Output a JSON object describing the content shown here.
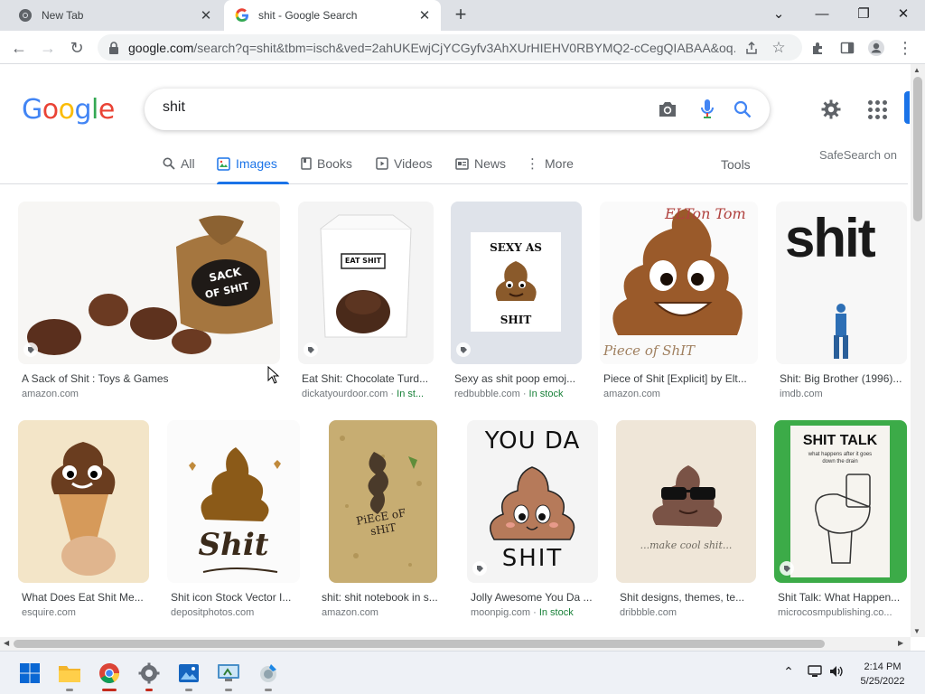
{
  "browser": {
    "tabs": [
      {
        "title": "New Tab",
        "icon": "chrome-icon",
        "active": false
      },
      {
        "title": "shit - Google Search",
        "icon": "google-g-icon",
        "active": true
      }
    ],
    "address": {
      "host": "google.com",
      "path": "/search?q=shit&tbm=isch&ved=2ahUKEwjCjYCGyfv3AhXUrHIEHV0RBYMQ2-cCegQIABAA&oq..."
    }
  },
  "google": {
    "logo_letters": [
      "G",
      "o",
      "o",
      "g",
      "l",
      "e"
    ],
    "logo_colors": [
      "#4285F4",
      "#EA4335",
      "#FBBC05",
      "#4285F4",
      "#34A853",
      "#EA4335"
    ],
    "query": "shit",
    "tabs": [
      {
        "label": "All",
        "icon": "search-icon",
        "active": false
      },
      {
        "label": "Images",
        "icon": "image-icon",
        "active": true
      },
      {
        "label": "Books",
        "icon": "book-icon",
        "active": false
      },
      {
        "label": "Videos",
        "icon": "video-icon",
        "active": false
      },
      {
        "label": "News",
        "icon": "news-icon",
        "active": false
      },
      {
        "label": "More",
        "icon": "more-vert-icon",
        "active": false
      }
    ],
    "tools_label": "Tools",
    "safesearch": "SafeSearch on",
    "accent": "#1a73e8"
  },
  "results": [
    {
      "title": "A Sack of Shit : Toys & Games",
      "source": "amazon.com",
      "stock": ""
    },
    {
      "title": "Eat Shit: Chocolate Turd...",
      "source": "dickatyourdoor.com · ",
      "stock": "In st..."
    },
    {
      "title": "Sexy as shit poop emoj...",
      "source": "redbubble.com · ",
      "stock": "In stock"
    },
    {
      "title": "Piece of Shit [Explicit] by Elt...",
      "source": "amazon.com",
      "stock": ""
    },
    {
      "title": "Shit: Big Brother (1996)...",
      "source": "imdb.com",
      "stock": ""
    },
    {
      "title": "What Does Eat Shit Me...",
      "source": "esquire.com",
      "stock": ""
    },
    {
      "title": "Shit icon Stock Vector I...",
      "source": "depositphotos.com",
      "stock": ""
    },
    {
      "title": "shit: shit notebook in s...",
      "source": "amazon.com",
      "stock": ""
    },
    {
      "title": "Jolly Awesome You Da ...",
      "source": "moonpig.com · ",
      "stock": "In stock"
    },
    {
      "title": "Shit designs, themes, te...",
      "source": "dribbble.com",
      "stock": ""
    },
    {
      "title": "Shit Talk: What Happen...",
      "source": "microcosmpublishing.co...",
      "stock": ""
    }
  ],
  "image_text": {
    "sack": "SACK OF SHIT",
    "eat": "EAT SHIT",
    "sexy_top": "SEXY AS",
    "sexy_bottom": "SHIT",
    "elton_top": "ELTon Tom",
    "elton_bottom": "Piece of ShIT",
    "bigbrother": "shit",
    "icon_word": "Shit",
    "notebook": "PiEcE oF sHiT",
    "youda_top": "YOU DA",
    "youda_bottom": "SHIT",
    "cool": "...make cool shit...",
    "talk_title": "SHIT TALK",
    "talk_sub": "what happens after it goes down the drain"
  },
  "taskbar": {
    "apps": [
      "windows-start-icon",
      "file-explorer-icon",
      "chrome-icon",
      "settings-icon",
      "photos-icon",
      "remote-desktop-icon",
      "disk-cleanup-icon"
    ],
    "time": "2:14 PM",
    "date": "5/25/2022"
  }
}
